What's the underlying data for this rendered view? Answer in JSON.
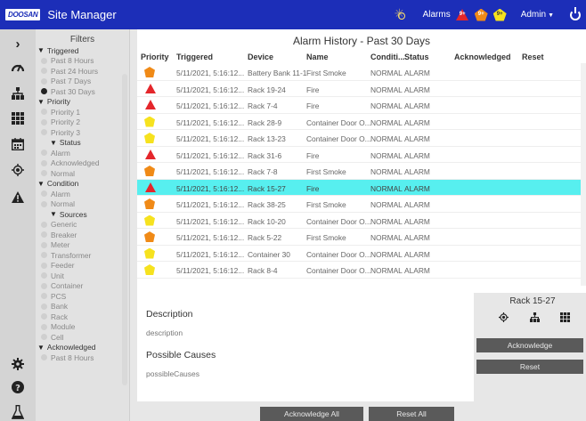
{
  "header": {
    "logo": "DOOSAN",
    "title": "Site Manager",
    "alarms_label": "Alarms",
    "badges": [
      {
        "count": "9+",
        "color": "#e4262b"
      },
      {
        "count": "9+",
        "color": "#f08a17"
      },
      {
        "count": "9+",
        "color": "#f6e21e"
      }
    ],
    "user": "Admin",
    "user_caret": "▼"
  },
  "rail": {
    "collapse": "›"
  },
  "filters": {
    "title": "Filters",
    "rows": [
      {
        "kind": "header",
        "label": "Triggered",
        "indent": 0
      },
      {
        "kind": "option",
        "label": "Past 8 Hours",
        "indent": 1,
        "on": false
      },
      {
        "kind": "option",
        "label": "Past 24 Hours",
        "indent": 1,
        "on": false
      },
      {
        "kind": "option",
        "label": "Past 7 Days",
        "indent": 1,
        "on": false
      },
      {
        "kind": "option",
        "label": "Past 30 Days",
        "indent": 1,
        "on": true
      },
      {
        "kind": "header",
        "label": "Priority",
        "indent": 0
      },
      {
        "kind": "option",
        "label": "Priority 1",
        "indent": 1,
        "on": false
      },
      {
        "kind": "option",
        "label": "Priority 2",
        "indent": 1,
        "on": false
      },
      {
        "kind": "option",
        "label": "Priority 3",
        "indent": 1,
        "on": false
      },
      {
        "kind": "header",
        "label": "Status",
        "indent": 2
      },
      {
        "kind": "option",
        "label": "Alarm",
        "indent": 1,
        "on": false
      },
      {
        "kind": "option",
        "label": "Acknowledged",
        "indent": 1,
        "on": false
      },
      {
        "kind": "option",
        "label": "Normal",
        "indent": 1,
        "on": false
      },
      {
        "kind": "header",
        "label": "Condition",
        "indent": 0
      },
      {
        "kind": "option",
        "label": "Alarm",
        "indent": 1,
        "on": false
      },
      {
        "kind": "option",
        "label": "Normal",
        "indent": 1,
        "on": false
      },
      {
        "kind": "header",
        "label": "Sources",
        "indent": 2
      },
      {
        "kind": "option",
        "label": "Generic",
        "indent": 1,
        "on": false
      },
      {
        "kind": "option",
        "label": "Breaker",
        "indent": 1,
        "on": false
      },
      {
        "kind": "option",
        "label": "Meter",
        "indent": 1,
        "on": false
      },
      {
        "kind": "option",
        "label": "Transformer",
        "indent": 1,
        "on": false
      },
      {
        "kind": "option",
        "label": "Feeder",
        "indent": 1,
        "on": false
      },
      {
        "kind": "option",
        "label": "Unit",
        "indent": 1,
        "on": false
      },
      {
        "kind": "option",
        "label": "Container",
        "indent": 1,
        "on": false
      },
      {
        "kind": "option",
        "label": "PCS",
        "indent": 1,
        "on": false
      },
      {
        "kind": "option",
        "label": "Bank",
        "indent": 1,
        "on": false
      },
      {
        "kind": "option",
        "label": "Rack",
        "indent": 1,
        "on": false
      },
      {
        "kind": "option",
        "label": "Module",
        "indent": 1,
        "on": false
      },
      {
        "kind": "option",
        "label": "Cell",
        "indent": 1,
        "on": false
      },
      {
        "kind": "header",
        "label": "Acknowledged",
        "indent": 0
      },
      {
        "kind": "option",
        "label": "Past 8 Hours",
        "indent": 1,
        "on": false
      }
    ]
  },
  "history": {
    "title": "Alarm History - Past 30 Days",
    "columns": {
      "priority": "Priority",
      "triggered": "Triggered",
      "device": "Device",
      "name": "Name",
      "condition": "Conditi...",
      "status": "Status",
      "acknowledged": "Acknowledged",
      "reset": "Reset"
    },
    "rows": [
      {
        "priority": "med",
        "triggered": "5/11/2021, 5:16:12...",
        "device": "Battery Bank 11-1",
        "name": "First Smoke",
        "condition": "NORMAL",
        "status": "ALARM",
        "selected": false
      },
      {
        "priority": "high",
        "triggered": "5/11/2021, 5:16:12...",
        "device": "Rack 19-24",
        "name": "Fire",
        "condition": "NORMAL",
        "status": "ALARM",
        "selected": false
      },
      {
        "priority": "high",
        "triggered": "5/11/2021, 5:16:12...",
        "device": "Rack 7-4",
        "name": "Fire",
        "condition": "NORMAL",
        "status": "ALARM",
        "selected": false
      },
      {
        "priority": "low",
        "triggered": "5/11/2021, 5:16:12...",
        "device": "Rack 28-9",
        "name": "Container Door O...",
        "condition": "NORMAL",
        "status": "ALARM",
        "selected": false
      },
      {
        "priority": "low",
        "triggered": "5/11/2021, 5:16:12...",
        "device": "Rack 13-23",
        "name": "Container Door O...",
        "condition": "NORMAL",
        "status": "ALARM",
        "selected": false
      },
      {
        "priority": "high",
        "triggered": "5/11/2021, 5:16:12...",
        "device": "Rack 31-6",
        "name": "Fire",
        "condition": "NORMAL",
        "status": "ALARM",
        "selected": false
      },
      {
        "priority": "med",
        "triggered": "5/11/2021, 5:16:12...",
        "device": "Rack 7-8",
        "name": "First Smoke",
        "condition": "NORMAL",
        "status": "ALARM",
        "selected": false
      },
      {
        "priority": "high",
        "triggered": "5/11/2021, 5:16:12...",
        "device": "Rack 15-27",
        "name": "Fire",
        "condition": "NORMAL",
        "status": "ALARM",
        "selected": true
      },
      {
        "priority": "med",
        "triggered": "5/11/2021, 5:16:12...",
        "device": "Rack 38-25",
        "name": "First Smoke",
        "condition": "NORMAL",
        "status": "ALARM",
        "selected": false
      },
      {
        "priority": "low",
        "triggered": "5/11/2021, 5:16:12...",
        "device": "Rack 10-20",
        "name": "Container Door O...",
        "condition": "NORMAL",
        "status": "ALARM",
        "selected": false
      },
      {
        "priority": "med",
        "triggered": "5/11/2021, 5:16:12...",
        "device": "Rack 5-22",
        "name": "First Smoke",
        "condition": "NORMAL",
        "status": "ALARM",
        "selected": false
      },
      {
        "priority": "low",
        "triggered": "5/11/2021, 5:16:12...",
        "device": "Container 30",
        "name": "Container Door O...",
        "condition": "NORMAL",
        "status": "ALARM",
        "selected": false
      },
      {
        "priority": "low",
        "triggered": "5/11/2021, 5:16:12...",
        "device": "Rack 8-4",
        "name": "Container Door O...",
        "condition": "NORMAL",
        "status": "ALARM",
        "selected": false
      }
    ]
  },
  "details": {
    "description_heading": "Description",
    "description_value": "description",
    "causes_heading": "Possible Causes",
    "causes_value": "possibleCauses"
  },
  "device_panel": {
    "device": "Rack 15-27",
    "acknowledge_label": "Acknowledge",
    "reset_label": "Reset"
  },
  "footer": {
    "acknowledge_all_label": "Acknowledge All",
    "reset_all_label": "Reset All"
  }
}
